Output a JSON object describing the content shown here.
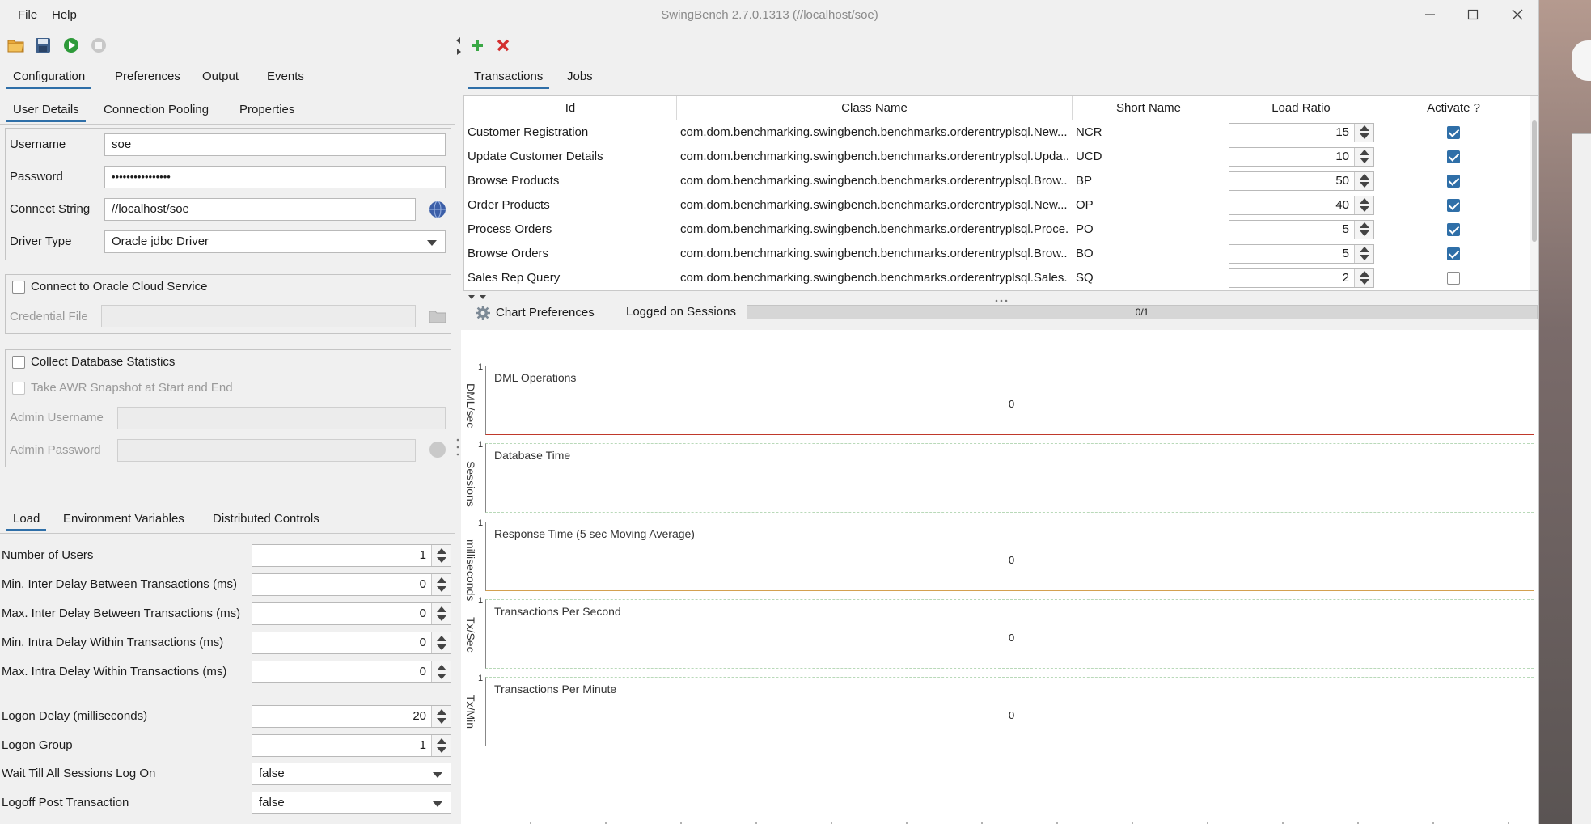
{
  "window": {
    "title": "SwingBench 2.7.0.1313  (//localhost/soe)"
  },
  "menu": {
    "file": "File",
    "help": "Help"
  },
  "toolbar": {
    "icons": [
      "open-folder-icon",
      "save-icon",
      "start-icon",
      "stop-icon"
    ],
    "add_icon": "add-icon",
    "remove_icon": "delete-icon"
  },
  "left_tabs": [
    "Configuration",
    "Preferences",
    "Output",
    "Events"
  ],
  "sub_tabs": [
    "User Details",
    "Connection Pooling",
    "Properties"
  ],
  "user_details": {
    "username_label": "Username",
    "username": "soe",
    "password_label": "Password",
    "password": "••••••••••••••••",
    "connect_label": "Connect String",
    "connect": "//localhost/soe",
    "driver_label": "Driver Type",
    "driver": "Oracle jdbc Driver"
  },
  "cloud": {
    "checkbox_label": "Connect to Oracle Cloud Service",
    "credential_label": "Credential File",
    "credential": ""
  },
  "db_stats": {
    "collect_label": "Collect Database Statistics",
    "awr_label": "Take AWR Snapshot at Start and End",
    "admin_user_label": "Admin Username",
    "admin_pass_label": "Admin Password"
  },
  "load_tabs": [
    "Load",
    "Environment Variables",
    "Distributed Controls"
  ],
  "load": [
    {
      "label": "Number of Users",
      "value": "1"
    },
    {
      "label": "Min. Inter Delay Between Transactions (ms)",
      "value": "0"
    },
    {
      "label": "Max. Inter Delay Between Transactions (ms)",
      "value": "0"
    },
    {
      "label": "Min. Intra Delay Within Transactions (ms)",
      "value": "0"
    },
    {
      "label": "Max. Intra Delay Within Transactions (ms)",
      "value": "0"
    }
  ],
  "logon": {
    "delay_label": "Logon Delay (milliseconds)",
    "delay": "20",
    "group_label": "Logon Group",
    "group": "1",
    "wait_label": "Wait Till All Sessions Log On",
    "wait": "false",
    "logoff_label": "Logoff Post Transaction",
    "logoff": "false"
  },
  "right_tabs": [
    "Transactions",
    "Jobs"
  ],
  "tx_columns": [
    "Id",
    "Class Name",
    "Short Name",
    "Load Ratio",
    "Activate ?"
  ],
  "transactions": [
    {
      "id": "Customer Registration",
      "class": "com.dom.benchmarking.swingbench.benchmarks.orderentryplsql.New...",
      "short": "NCR",
      "ratio": "15",
      "active": true
    },
    {
      "id": "Update Customer Details",
      "class": "com.dom.benchmarking.swingbench.benchmarks.orderentryplsql.Upda...",
      "short": "UCD",
      "ratio": "10",
      "active": true
    },
    {
      "id": "Browse Products",
      "class": "com.dom.benchmarking.swingbench.benchmarks.orderentryplsql.Brow...",
      "short": "BP",
      "ratio": "50",
      "active": true
    },
    {
      "id": "Order Products",
      "class": "com.dom.benchmarking.swingbench.benchmarks.orderentryplsql.New...",
      "short": "OP",
      "ratio": "40",
      "active": true
    },
    {
      "id": "Process Orders",
      "class": "com.dom.benchmarking.swingbench.benchmarks.orderentryplsql.Proce...",
      "short": "PO",
      "ratio": "5",
      "active": true
    },
    {
      "id": "Browse Orders",
      "class": "com.dom.benchmarking.swingbench.benchmarks.orderentryplsql.Brow...",
      "short": "BO",
      "ratio": "5",
      "active": true
    },
    {
      "id": "Sales Rep Query",
      "class": "com.dom.benchmarking.swingbench.benchmarks.orderentryplsql.Sales...",
      "short": "SQ",
      "ratio": "2",
      "active": false
    }
  ],
  "chart_bar": {
    "prefs_label": "Chart Preferences",
    "sessions_label": "Logged on Sessions",
    "sessions_value": "0/1",
    "sessions_fraction": 0
  },
  "charts": [
    {
      "title": "DML Operations",
      "ylabel": "DML/sec",
      "value": "0",
      "ytick": "1"
    },
    {
      "title": "Database Time",
      "ylabel": "Sessions",
      "value": "",
      "ytick": "1"
    },
    {
      "title": "Response Time (5 sec Moving Average)",
      "ylabel": "milliseconds",
      "value": "0",
      "ytick": "1"
    },
    {
      "title": "Transactions Per Second",
      "ylabel": "Tx/Sec",
      "value": "0",
      "ytick": "1"
    },
    {
      "title": "Transactions Per Minute",
      "ylabel": "Tx/Min",
      "value": "0",
      "ytick": "1"
    }
  ],
  "colors": {
    "accent": "#2f6fa8",
    "checked": "#2f6fa8",
    "dml_line": "#c0392b",
    "response_line": "#d4a050"
  }
}
